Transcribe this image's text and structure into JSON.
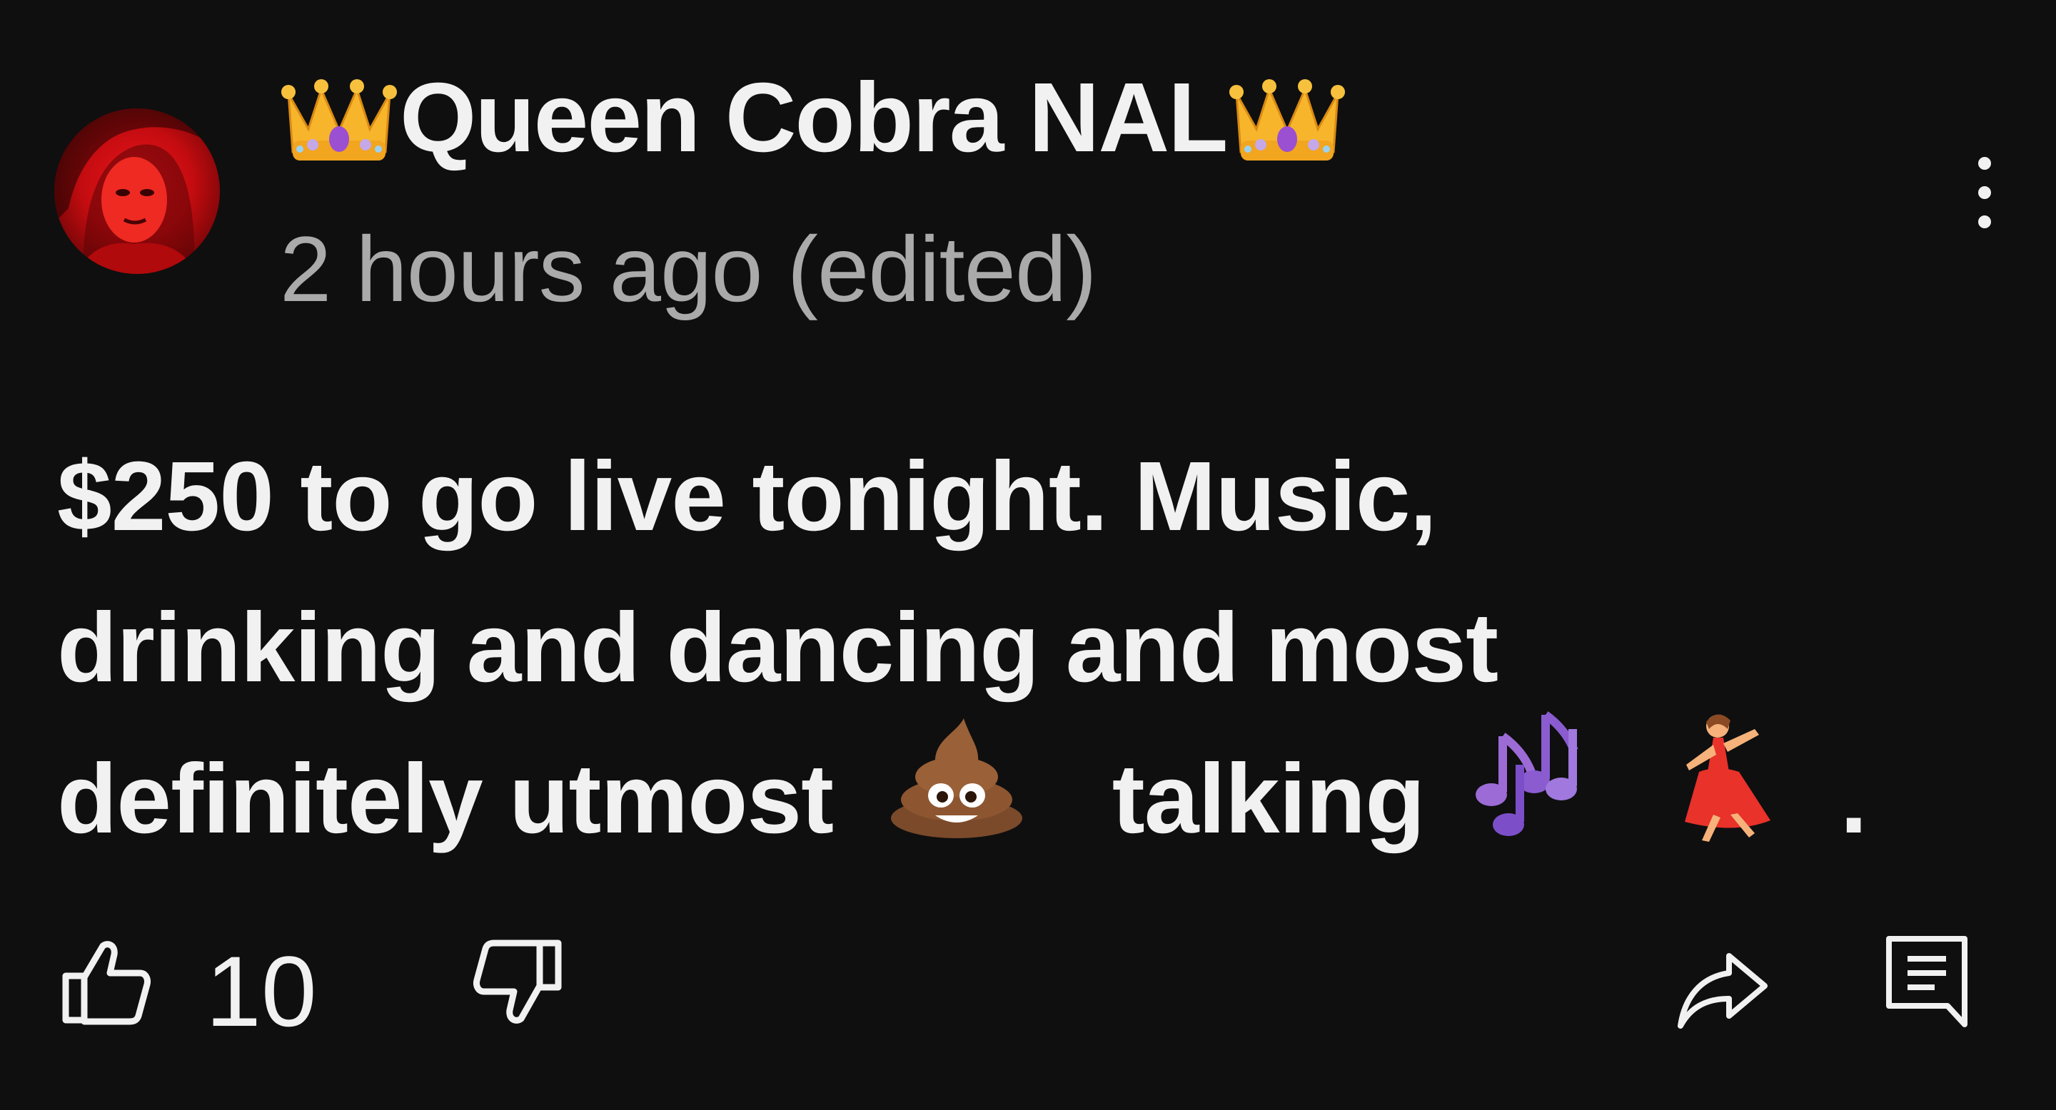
{
  "comment": {
    "author": {
      "prefix_icon": "crown-emoji",
      "name": "Queen Cobra NAL",
      "suffix_icon": "crown-emoji"
    },
    "timestamp": "2 hours ago (edited)",
    "body": {
      "line1": "$250 to go live tonight. Music,",
      "line2": "drinking and dancing and most",
      "line3_start": "definitely utmost",
      "line3_emoji1": "pile-of-poo-emoji",
      "line3_mid": "talking",
      "line3_emoji2": "musical-notes-emoji",
      "line3_emoji3": "woman-dancing-emoji",
      "line3_end": "."
    },
    "actions": {
      "like_count": "10"
    },
    "menu_icon": "more-vertical-icon"
  },
  "colors": {
    "background": "#0f0f0f",
    "primary_text": "#f1f1f1",
    "secondary_text": "#aaaaaa",
    "avatar_red": "#d3100f"
  }
}
